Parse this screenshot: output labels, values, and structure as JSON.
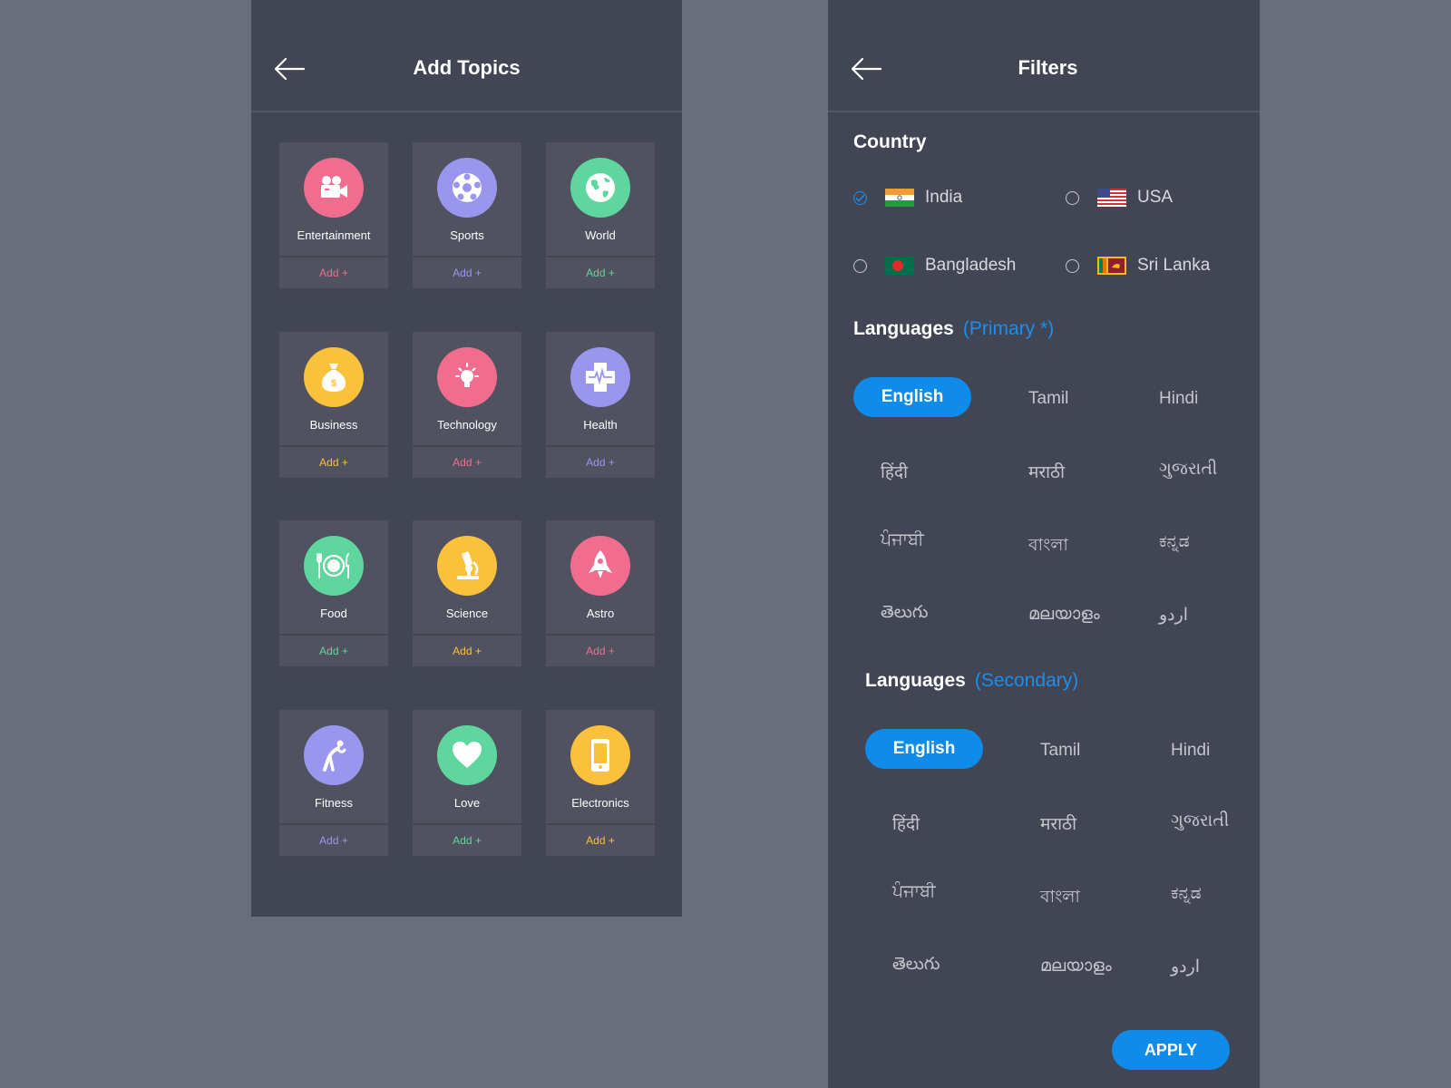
{
  "left": {
    "title": "Add Topics",
    "topics": [
      {
        "name": "Entertainment",
        "add": "Add +",
        "color": "#f06d8f",
        "icon": "film-camera-icon"
      },
      {
        "name": "Sports",
        "add": "Add +",
        "color": "#9a95ee",
        "icon": "soccer-ball-icon"
      },
      {
        "name": "World",
        "add": "Add +",
        "color": "#5ed69d",
        "icon": "globe-icon"
      },
      {
        "name": "Business",
        "add": "Add +",
        "color": "#fbc03c",
        "icon": "money-bag-icon"
      },
      {
        "name": "Technology",
        "add": "Add +",
        "color": "#f06d8f",
        "icon": "lightbulb-icon"
      },
      {
        "name": "Health",
        "add": "Add +",
        "color": "#9a95ee",
        "icon": "medical-cross-icon"
      },
      {
        "name": "Food",
        "add": "Add +",
        "color": "#5ed69d",
        "icon": "plate-cutlery-icon"
      },
      {
        "name": "Science",
        "add": "Add +",
        "color": "#fbc03c",
        "icon": "microscope-icon"
      },
      {
        "name": "Astro",
        "add": "Add +",
        "color": "#f06d8f",
        "icon": "rocket-icon"
      },
      {
        "name": "Fitness",
        "add": "Add +",
        "color": "#9a95ee",
        "icon": "stretching-person-icon"
      },
      {
        "name": "Love",
        "add": "Add +",
        "color": "#5ed69d",
        "icon": "heart-icon"
      },
      {
        "name": "Electronics",
        "add": "Add +",
        "color": "#fbc03c",
        "icon": "smartphone-icon"
      }
    ]
  },
  "right": {
    "title": "Filters",
    "country_heading": "Country",
    "countries": [
      {
        "label": "India",
        "checked": true,
        "icon": "india-flag-icon"
      },
      {
        "label": "USA",
        "checked": false,
        "icon": "usa-flag-icon"
      },
      {
        "label": "Bangladesh",
        "checked": false,
        "icon": "bangladesh-flag-icon"
      },
      {
        "label": "Sri Lanka",
        "checked": false,
        "icon": "sri-lanka-flag-icon"
      }
    ],
    "primary": {
      "heading": "Languages",
      "accent": "(Primary *)",
      "selected": "English",
      "langs": [
        "Tamil",
        "Hindi",
        "हिंदी",
        "मराठी",
        "ગુજરાતી",
        "ਪੰਜਾਬੀ",
        "বাংলা",
        "ಕನ್ನಡ",
        "తెలుగు",
        "മലയാളം",
        "اردو"
      ]
    },
    "secondary": {
      "heading": "Languages",
      "accent": "(Secondary)",
      "selected": "English",
      "langs": [
        "Tamil",
        "Hindi",
        "हिंदी",
        "मराठी",
        "ગુજરાતી",
        "ਪੰਜਾਬੀ",
        "বাংলা",
        "ಕನ್ನಡ",
        "తెలుగు",
        "മലയാളം",
        "اردو"
      ]
    },
    "apply": "APPLY"
  },
  "colors": {
    "accent": "#0f8ce9",
    "panel": "#424553",
    "card": "#50535f",
    "page": "#6a6e7a"
  }
}
